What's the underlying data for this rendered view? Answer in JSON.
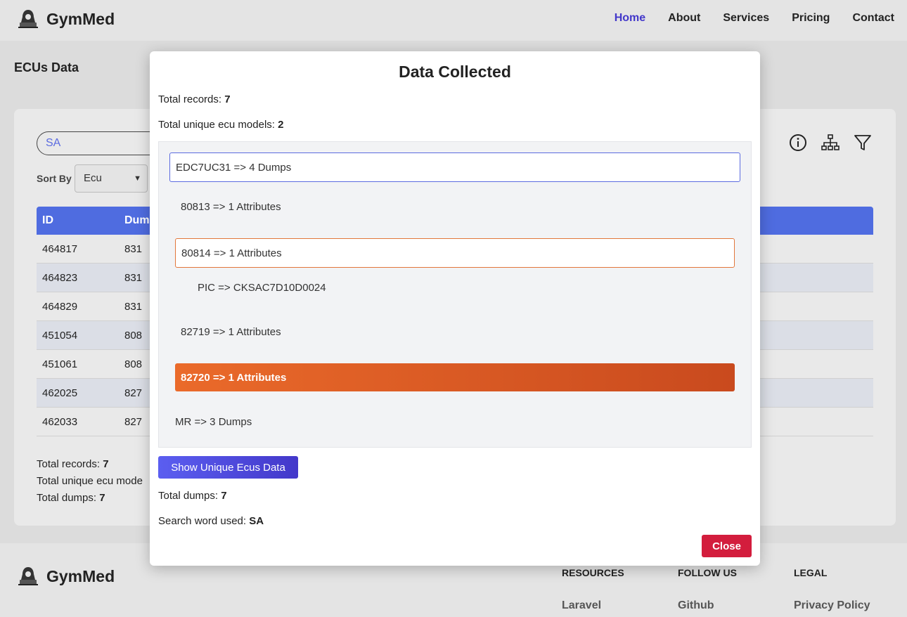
{
  "brand": {
    "name": "GymMed",
    "logo_icon": "hacker-icon"
  },
  "nav": {
    "items": [
      "Home",
      "About",
      "Services",
      "Pricing",
      "Contact"
    ],
    "active": "Home"
  },
  "page": {
    "title": "ECUs Data",
    "search_value": "SA",
    "sort_label": "Sort By",
    "sort_value": "Ecu",
    "table": {
      "headers": [
        "ID",
        "Dum"
      ],
      "rows": [
        [
          "464817",
          "831"
        ],
        [
          "464823",
          "831"
        ],
        [
          "464829",
          "831"
        ],
        [
          "451054",
          "808"
        ],
        [
          "451061",
          "808"
        ],
        [
          "462025",
          "827"
        ],
        [
          "462033",
          "827"
        ]
      ]
    },
    "summary": {
      "records_label": "Total records:",
      "records_value": "7",
      "unique_label": "Total unique ecu mode",
      "dumps_label": "Total dumps:",
      "dumps_value": "7"
    }
  },
  "modal": {
    "title": "Data Collected",
    "total_records_label": "Total records:",
    "total_records_value": "7",
    "unique_label": "Total unique ecu models:",
    "unique_value": "2",
    "tree": {
      "ecu1": "EDC7UC31 => 4 Dumps",
      "d1": "80813 => 1 Attributes",
      "d2": "80814 => 1 Attributes",
      "d2_attr": "PIC => CKSAC7D10D0024",
      "d3": "82719 => 1 Attributes",
      "d4": "82720 => 1 Attributes",
      "ecu2": "MR => 3 Dumps"
    },
    "show_button": "Show Unique Ecus Data",
    "total_dumps_label": "Total dumps:",
    "total_dumps_value": "7",
    "search_word_label": "Search word used:",
    "search_word_value": "SA",
    "close_button": "Close"
  },
  "footer": {
    "columns": [
      {
        "title": "RESOURCES",
        "link": "Laravel"
      },
      {
        "title": "FOLLOW US",
        "link": "Github"
      },
      {
        "title": "LEGAL",
        "link": "Privacy Policy"
      }
    ]
  },
  "colors": {
    "accent": "#4338ca",
    "table_header": "#4f6ce0",
    "orange": "#e2773b",
    "close": "#d31d3d"
  }
}
